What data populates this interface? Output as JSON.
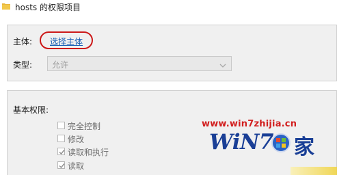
{
  "window": {
    "title": "hosts 的权限项目"
  },
  "principal": {
    "label": "主体:",
    "link_text": "选择主体"
  },
  "type": {
    "label": "类型:",
    "selected": "允许"
  },
  "basic_permissions": {
    "label": "基本权限:",
    "items": [
      {
        "label": "完全控制",
        "checked": false
      },
      {
        "label": "修改",
        "checked": false
      },
      {
        "label": "读取和执行",
        "checked": true
      },
      {
        "label": "读取",
        "checked": true
      }
    ]
  },
  "watermark": {
    "url": "www.win7zhijia.cn",
    "logo_text": "WiN7.",
    "logo_suffix": "家"
  },
  "colors": {
    "link": "#1a5fb4",
    "highlight": "#cc1818",
    "watermark_url": "#d21f1f",
    "watermark_logo": "#1a3f96"
  }
}
